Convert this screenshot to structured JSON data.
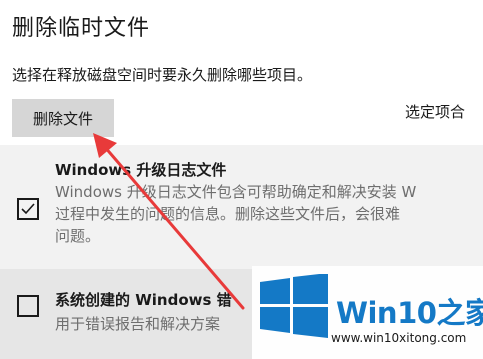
{
  "page": {
    "title": "删除临时文件",
    "description": "选择在释放磁盘空间时要永久删除哪些项目。"
  },
  "actions": {
    "delete_label": "删除文件",
    "selected_total": "选定项合"
  },
  "files": [
    {
      "title": "Windows 升级日志文件",
      "checked": true,
      "description_lines": [
        "Windows 升级日志文件包含可帮助确定和解决安装 W",
        "过程中发生的问题的信息。删除这些文件后，会很难",
        "问题。"
      ]
    },
    {
      "title": "系统创建的 Windows 错",
      "checked": false,
      "description_lines": [
        "用于错误报告和解决方案"
      ]
    }
  ],
  "watermark": {
    "brand": "Win10",
    "brand_suffix": "之家",
    "url": "www.win10xitong.com"
  },
  "colors": {
    "accent_arrow": "#e83a3a",
    "watermark_blue": "#1479c6",
    "button_bg": "#d6d6d6"
  }
}
